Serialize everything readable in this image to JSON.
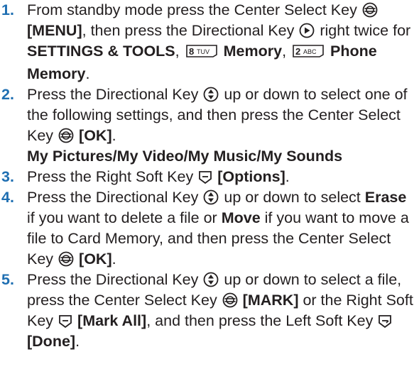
{
  "steps": [
    {
      "num": "1.",
      "t1": "From standby mode press the Center Select Key",
      "t2": "[MENU]",
      "t3": ", then press the Directional Key",
      "t4": "right twice for",
      "t5": "SETTINGS & TOOLS",
      "t6": ",",
      "t7": "Memory",
      "t8": ",",
      "t9": "Phone Memory",
      "t10": ".",
      "key8_label": "TUV",
      "key2_label": "ABC"
    },
    {
      "num": "2.",
      "t1": "Press the Directional Key",
      "t2": "up or down to select one of the following settings, and then press the Center Select Key",
      "t3": "[OK]",
      "t4": "."
    },
    {
      "sub": "My Pictures/My Video/My Music/My Sounds"
    },
    {
      "num": "3.",
      "t1": "Press the Right Soft Key",
      "t2": "[Options]",
      "t3": "."
    },
    {
      "num": "4.",
      "t1": "Press the Directional Key",
      "t2": "up or down to select",
      "t3": "Erase",
      "t4": "if you want to delete a file or",
      "t5": "Move",
      "t6": "if you want to move a file to Card Memory, and then press the Center Select Key",
      "t7": "[OK]",
      "t8": "."
    },
    {
      "num": "5.",
      "t1": "Press the Directional Key",
      "t2": "up or down to select a file, press the Center Select Key",
      "t3": "[MARK]",
      "t4": "or the Right Soft Key",
      "t5": "[Mark All]",
      "t6": ", and then press the Left Soft Key",
      "t7": "[Done]",
      "t8": "."
    }
  ],
  "icons": {
    "center_select": "center-select-key-icon",
    "directional_right": "directional-right-icon",
    "directional_updown": "directional-updown-icon",
    "right_soft": "right-soft-key-icon",
    "left_soft": "left-soft-key-icon",
    "key_8": "key-8-tuv-icon",
    "key_2": "key-2-abc-icon"
  },
  "colors": {
    "step_number": "#1f6fb2",
    "text": "#231f20"
  }
}
